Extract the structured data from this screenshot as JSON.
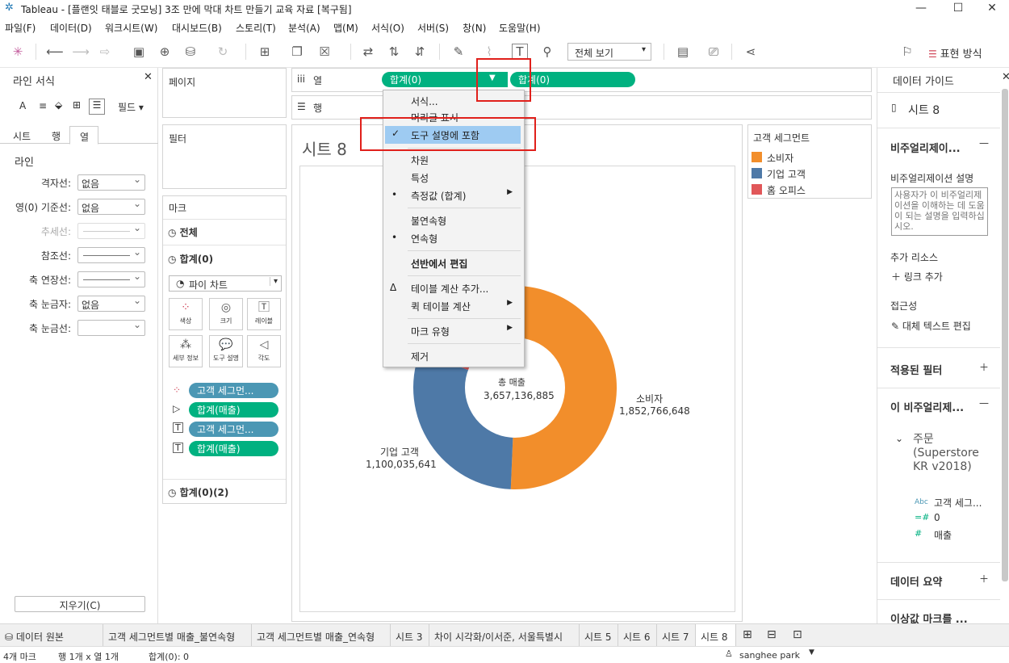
{
  "window": {
    "title": "Tableau - [플랜잇 태블로 굿모닝] 3조 만에 막대 차트 만들기 교육 자료 [복구됨]",
    "min": "—",
    "max": "☐",
    "close": "✕"
  },
  "menu": [
    "파일(F)",
    "데이터(D)",
    "워크시트(W)",
    "대시보드(B)",
    "스토리(T)",
    "분석(A)",
    "맵(M)",
    "서식(O)",
    "서버(S)",
    "창(N)",
    "도움말(H)"
  ],
  "toolbar": {
    "view_select": "전체 보기",
    "show_me": "표현 방식"
  },
  "left_pane": {
    "title": "라인 서식",
    "field_label": "필드",
    "tabs": [
      "시트",
      "행",
      "열"
    ],
    "section": "라인",
    "rows": [
      {
        "label": "격자선:",
        "value": "없음"
      },
      {
        "label": "영(0) 기준선:",
        "value": "없음"
      },
      {
        "label": "추세선:",
        "value": ""
      },
      {
        "label": "참조선:",
        "value": ""
      },
      {
        "label": "축 연장선:",
        "value": ""
      },
      {
        "label": "축 눈금자:",
        "value": "없음"
      },
      {
        "label": "축 눈금선:",
        "value": ""
      }
    ],
    "clear_button": "지우기(C)"
  },
  "pages_label": "페이지",
  "filters_label": "필터",
  "marks": {
    "title": "마크",
    "all": "전체",
    "sum0": "합계(0)",
    "mark_type": "파이 차트",
    "buttons": [
      "색상",
      "크기",
      "레이블",
      "세부 정보",
      "도구 설명",
      "각도"
    ],
    "pills": [
      {
        "label": "고객 세그먼..."
      },
      {
        "label": "합계(매출)"
      },
      {
        "label": "고객 세그먼..."
      },
      {
        "label": "합계(매출)"
      }
    ],
    "sum02": "합계(0)(2)"
  },
  "shelves": {
    "columns_label": "열",
    "rows_label": "행",
    "pill1": "합계(0)",
    "pill2": "합계(0)"
  },
  "sheet": {
    "title": "시트 8",
    "center_label": "총 매출",
    "center_value": "3,657,136,885"
  },
  "chart_data": {
    "type": "pie",
    "categories": [
      "소비자",
      "기업 고객",
      "홈 오피스"
    ],
    "values": [
      1852766648,
      1100035641,
      704334596
    ],
    "labels": [
      {
        "name": "소비자",
        "value": "1,852,766,648"
      },
      {
        "name": "기업 고객",
        "value": "1,100,035,641"
      }
    ],
    "colors": [
      "#f28e2b",
      "#4e79a7",
      "#e15759"
    ]
  },
  "legend": {
    "title": "고객 세그먼트",
    "items": [
      {
        "label": "소비자",
        "color": "#f28e2b"
      },
      {
        "label": "기업 고객",
        "color": "#4e79a7"
      },
      {
        "label": "홈 오피스",
        "color": "#e15759"
      }
    ]
  },
  "context_menu": {
    "items": [
      "서식...",
      "머리글 표시",
      "도구 설명에 포함",
      "차원",
      "특성",
      "측정값 (합계)",
      "불연속형",
      "연속형",
      "선반에서 편집",
      "테이블 계산 추가...",
      "퀵 테이블 계산",
      "마크 유형",
      "제거"
    ]
  },
  "right_pane": {
    "title": "데이터 가이드",
    "sheet": "시트 8",
    "viz_desc_header": "비주얼리제이...",
    "viz_desc_label": "비주얼리제이션 설명",
    "viz_desc_placeholder": "사용자가 이 비주얼리제이션을 이해하는 데 도움이 되는 설명을 입력하십시오.",
    "resources": "추가 리소스",
    "add_link": "링크 추가",
    "accessibility": "접근성",
    "alt_text": "대체 텍스트 편집",
    "applied_filters": "적용된 필터",
    "this_viz": "이 비주얼리제...",
    "datasource": "주문 (Superstore KR v2018)",
    "fields": [
      "고객 세그...",
      "0",
      "매출"
    ],
    "data_summary": "데이터 요약",
    "outliers": "이상값 마크를 ..."
  },
  "tabs": [
    "데이터 원본",
    "고객 세그먼트별 매출_불연속형",
    "고객 세그먼트별 매출_연속형",
    "시트 3",
    "차이 시각화/이서준, 서울특별시",
    "시트 5",
    "시트 6",
    "시트 7",
    "시트 8"
  ],
  "status": {
    "marks": "4개 마크",
    "rowcol": "행 1개 x 열 1개",
    "sum": "합계(0): 0",
    "user": "sanghee park"
  }
}
